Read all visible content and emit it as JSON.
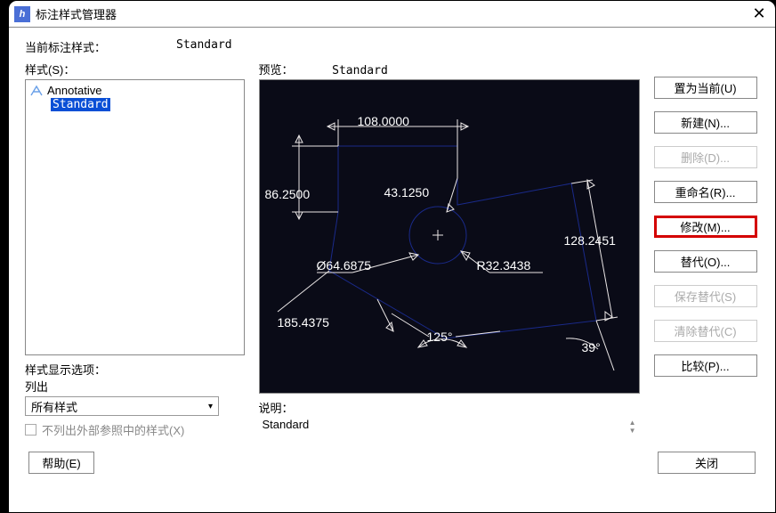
{
  "window": {
    "title": "标注样式管理器",
    "current_style_label": "当前标注样式：",
    "current_style_value": "Standard",
    "styles_label": "样式(S)：",
    "filter_group_label": "样式显示选项：",
    "filter_sub_label": "列出",
    "filter_value": "所有样式",
    "hide_xref_label": "不列出外部参照中的样式(X)",
    "preview_label": "预览：",
    "preview_value": "Standard",
    "desc_label": "说明：",
    "desc_value": "Standard"
  },
  "styles": {
    "annotative": "Annotative",
    "standard": "Standard"
  },
  "buttons": {
    "set_current": "置为当前(U)",
    "new": "新建(N)...",
    "delete": "删除(D)...",
    "rename": "重命名(R)...",
    "modify": "修改(M)...",
    "override": "替代(O)...",
    "save_override": "保存替代(S)",
    "clear_override": "清除替代(C)",
    "compare": "比较(P)...",
    "help": "帮助(E)",
    "close": "关闭"
  },
  "chart_data": {
    "type": "diagram",
    "title": "Dimension preview",
    "dimensions": {
      "top": "108.0000",
      "left": "86.2500",
      "radius_text": "43.1250",
      "diameter": "Ø64.6875",
      "radius": "R32.3438",
      "right": "128.2451",
      "bl": "185.4375",
      "angle_main": "125°",
      "angle_small": "39°"
    }
  }
}
